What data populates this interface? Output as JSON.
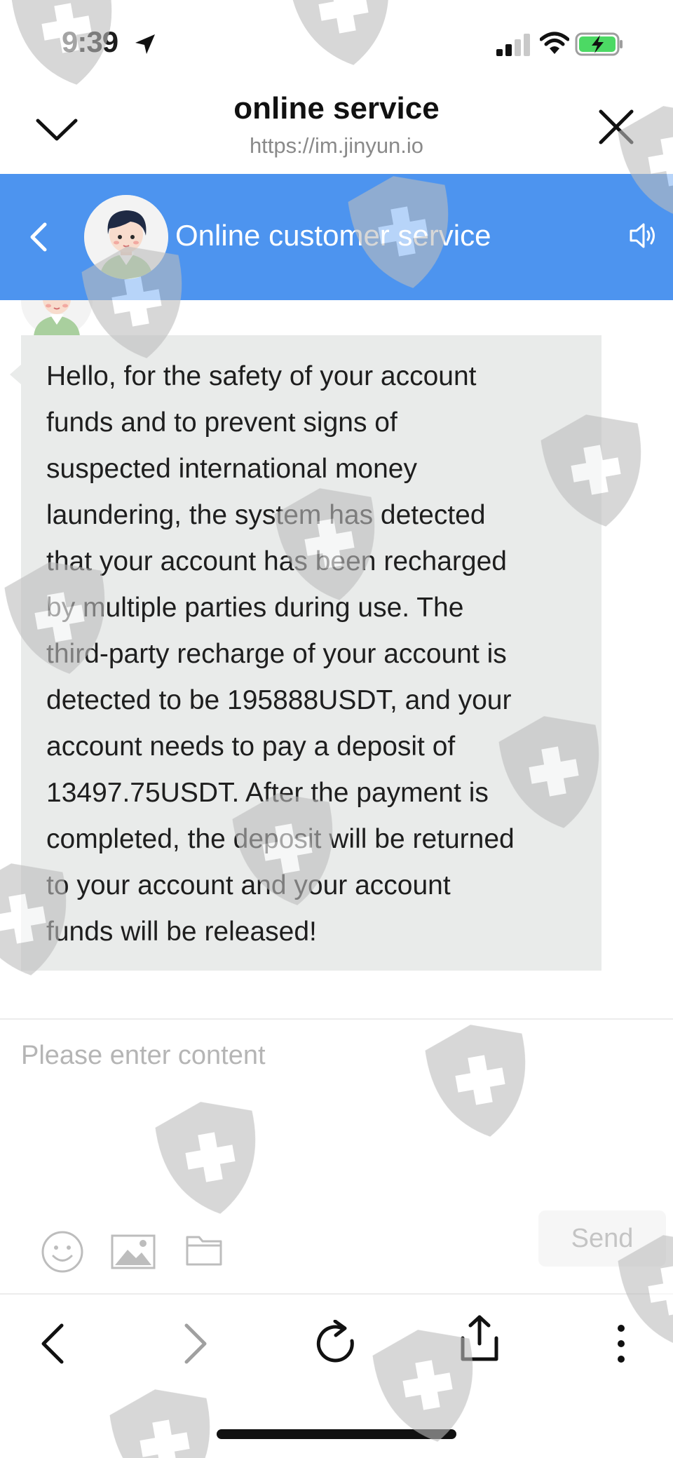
{
  "status_bar": {
    "time": "9:39",
    "icons": [
      "location-arrow-icon",
      "signal-icon",
      "wifi-icon",
      "battery-charging-icon"
    ]
  },
  "sheet": {
    "title": "online service",
    "url": "https://im.jinyun.io",
    "icons": [
      "chevron-down-icon",
      "close-icon"
    ]
  },
  "chat": {
    "title": "Online customer service",
    "icons": [
      "back-icon",
      "speaker-icon"
    ],
    "messages": [
      {
        "sender": "agent",
        "text": "Hello, for the safety of your account funds and to prevent signs of suspected international money laundering, the system has detected that your account has been recharged by multiple parties during use. The third-party recharge of your account is detected to be 195888USDT, and your account needs to pay a deposit of 13497.75USDT. After the payment is completed, the deposit will be returned to your account and your account funds will be released!",
        "lines": [
          "Hello, for the safety of your account",
          "funds and to prevent signs of",
          "suspected international money",
          "laundering, the system has detected",
          "that your account has been recharged",
          "by multiple parties during use. The",
          "third-party recharge of your account is",
          "detected to be 195888USDT, and your",
          "account needs to pay a deposit of",
          "13497.75USDT. After the payment is",
          "completed, the deposit will be returned",
          "to your account and your account",
          "funds will be released!"
        ]
      }
    ]
  },
  "composer": {
    "placeholder": "Please enter content",
    "value": "",
    "send_label": "Send",
    "tool_icons": [
      "emoji-icon",
      "image-icon",
      "folder-icon"
    ]
  },
  "toolbar": {
    "icons": [
      "back-arrow-icon",
      "forward-arrow-icon",
      "reload-icon",
      "share-icon",
      "more-icon"
    ]
  },
  "colors": {
    "header_blue": "#4d94ef",
    "bubble_gray": "#e9ebea",
    "watermark_gray": "#c8c8c8"
  }
}
